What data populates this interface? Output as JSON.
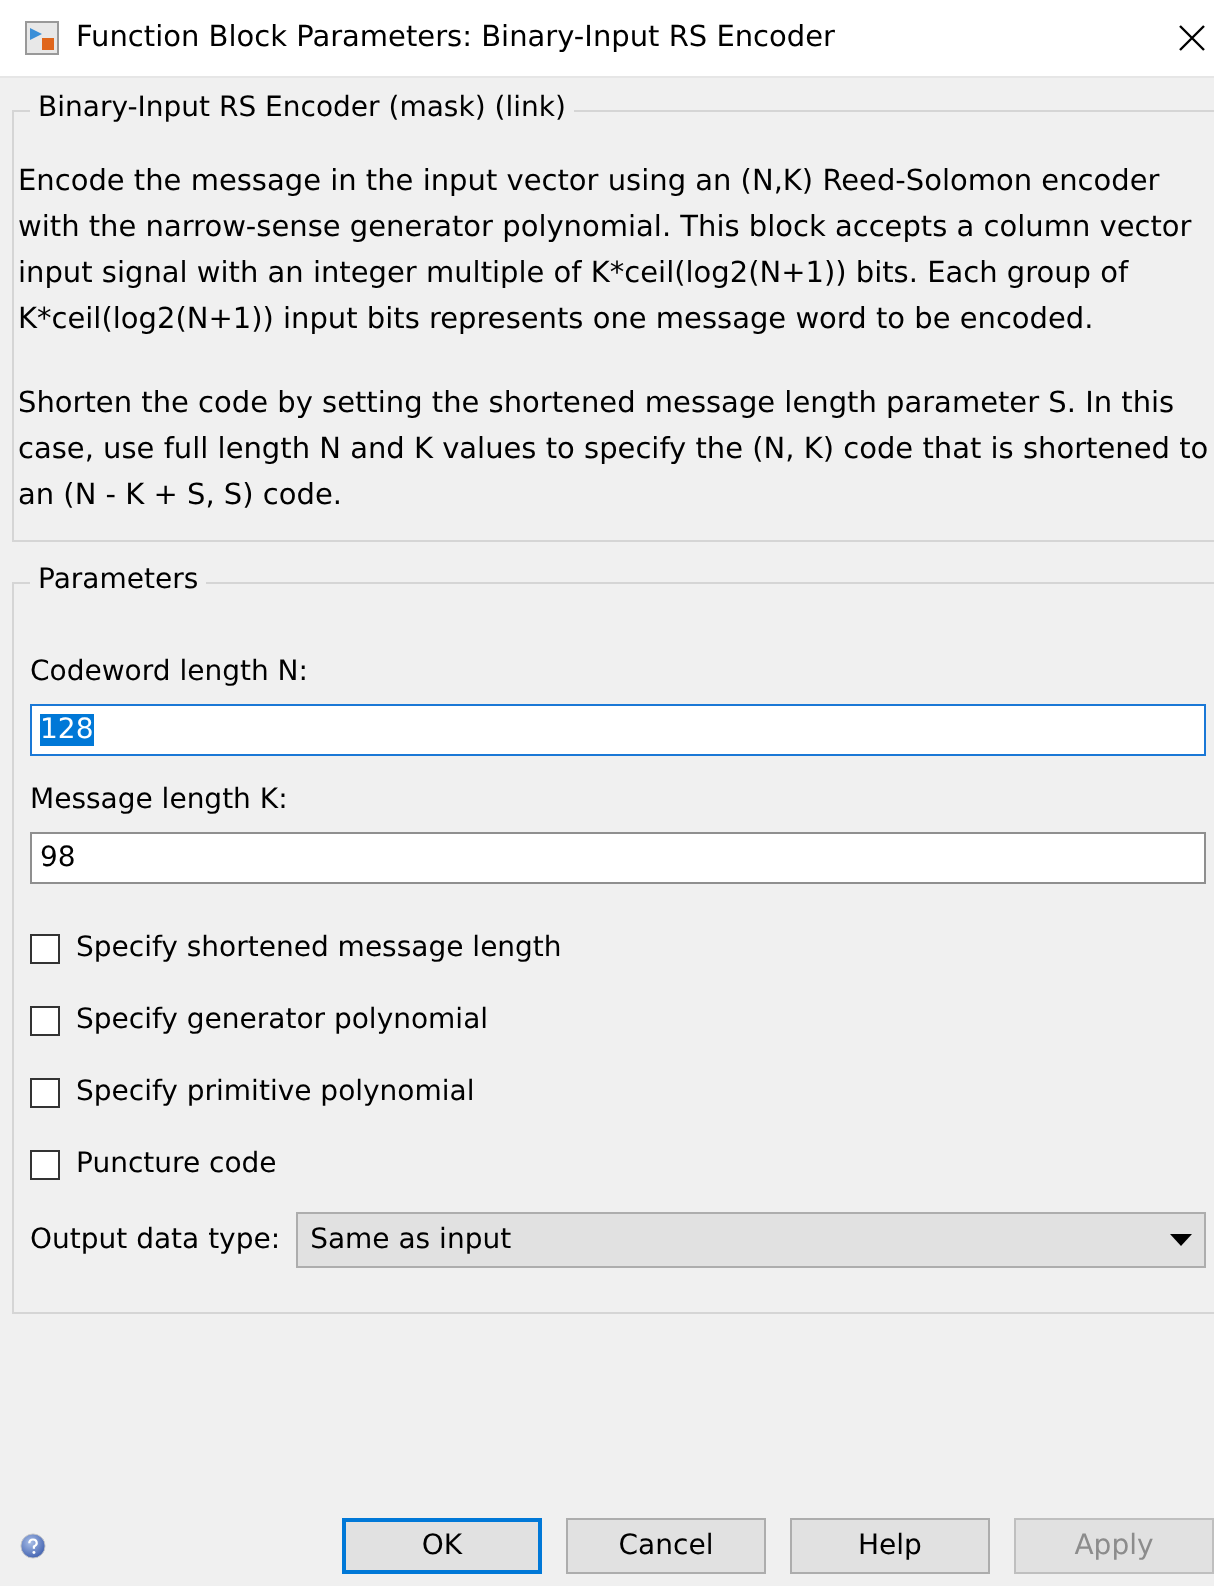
{
  "window": {
    "title": "Function Block Parameters: Binary-Input RS Encoder"
  },
  "description": {
    "title": "Binary-Input RS Encoder (mask) (link)",
    "paragraphs": [
      "Encode the message in the input vector using an (N,K) Reed-Solomon encoder with the narrow-sense generator polynomial.  This block accepts a column vector input signal with an integer multiple of K*ceil(log2(N+1)) bits.  Each group of K*ceil(log2(N+1)) input bits represents one message word to be encoded.",
      "Shorten the code by setting the shortened message length parameter S. In this case, use full length N and K values to specify the (N, K) code that is shortened to an (N - K + S, S) code."
    ]
  },
  "parameters": {
    "title": "Parameters",
    "fields": [
      {
        "label": "Codeword length N:",
        "value": "128",
        "focused": true
      },
      {
        "label": "Message length K:",
        "value": "98",
        "focused": false
      }
    ],
    "checkboxes": [
      {
        "label": "Specify shortened message length",
        "checked": false
      },
      {
        "label": "Specify generator polynomial",
        "checked": false
      },
      {
        "label": "Specify primitive polynomial",
        "checked": false
      },
      {
        "label": "Puncture code",
        "checked": false
      }
    ],
    "dropdown": {
      "label": "Output data type:",
      "value": "Same as input"
    }
  },
  "buttons": [
    {
      "label": "OK",
      "focused": true,
      "disabled": false
    },
    {
      "label": "Cancel",
      "focused": false,
      "disabled": false
    },
    {
      "label": "Help",
      "focused": false,
      "disabled": false
    },
    {
      "label": "Apply",
      "focused": false,
      "disabled": true
    }
  ]
}
